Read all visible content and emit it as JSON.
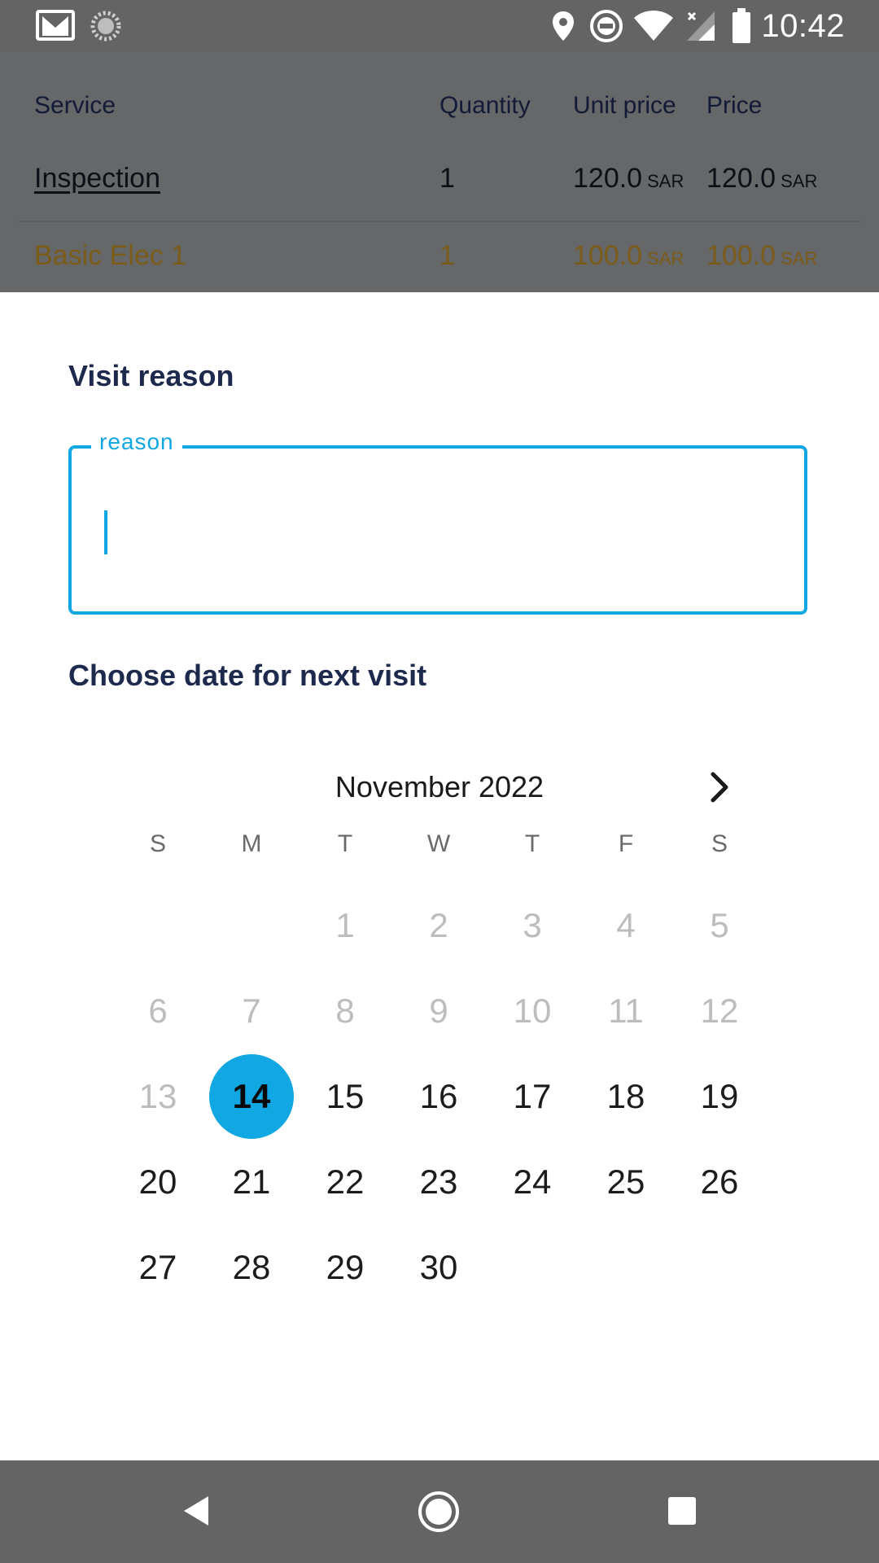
{
  "status_bar": {
    "time": "10:42",
    "icons": [
      "gmail-icon",
      "loading-icon",
      "location-icon",
      "dnd-icon",
      "wifi-icon",
      "signal-icon",
      "battery-icon"
    ]
  },
  "services_table": {
    "headers": {
      "service": "Service",
      "quantity": "Quantity",
      "unit_price": "Unit price",
      "price": "Price"
    },
    "rows": [
      {
        "service": "Inspection",
        "quantity": "1",
        "unit_price": "120.0",
        "price": "120.0",
        "currency": "SAR"
      },
      {
        "service": "Basic Elec 1",
        "quantity": "1",
        "unit_price": "100.0",
        "price": "100.0",
        "currency": "SAR"
      }
    ]
  },
  "sheet": {
    "visit_reason_title": "Visit reason",
    "reason_field": {
      "label": "reason",
      "value": ""
    },
    "next_visit_title": "Choose date for next visit"
  },
  "calendar": {
    "month_label": "November 2022",
    "weekday_headers": [
      "S",
      "M",
      "T",
      "W",
      "T",
      "F",
      "S"
    ],
    "first_weekday_index": 2,
    "days_in_month": 30,
    "selected_day": 14,
    "min_enabled_day": 14,
    "icons": {
      "next": "chevron-right-icon"
    }
  },
  "nav_bar": {
    "icons": [
      "back-icon",
      "home-icon",
      "recents-icon"
    ]
  },
  "colors": {
    "accent": "#10a7e3",
    "title": "#1e2a4d",
    "overlay": "#646464",
    "highlight_row_text": "#7a5b17"
  }
}
